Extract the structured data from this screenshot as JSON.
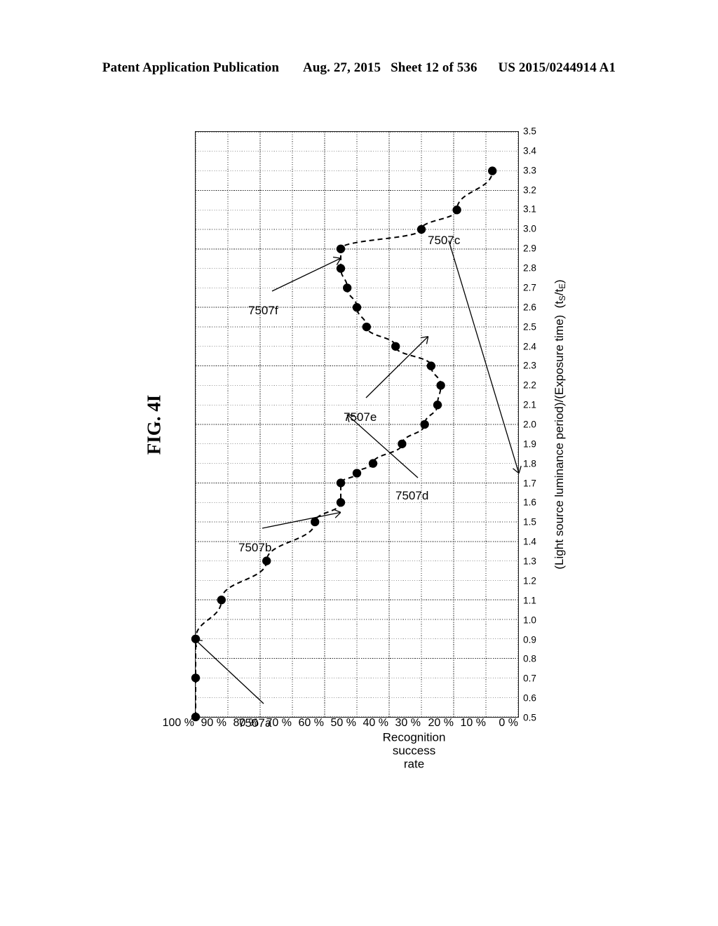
{
  "header": {
    "publication": "Patent Application Publication",
    "date": "Aug. 27, 2015",
    "sheet": "Sheet 12 of 536",
    "docket": "US 2015/0244914 A1"
  },
  "figure": {
    "label": "FIG. 4I"
  },
  "chart_data": {
    "type": "scatter",
    "title": "",
    "xlabel": "(Light source luminance period)/(Exposure time)  (tS/tE)",
    "xlabel_parts": {
      "main": "(Light source luminance period)/(Exposure time)",
      "ratio_open": "(t",
      "sub1": "S",
      "slash": "/t",
      "sub2": "E",
      "ratio_close": ")"
    },
    "ylabel_lines": [
      "Recognition",
      "success",
      "rate"
    ],
    "ylabel": "Recognition success rate",
    "xlim": [
      0.5,
      3.5
    ],
    "ylim": [
      0,
      100
    ],
    "grid": true,
    "legend": "none",
    "xticks": [
      "0.5",
      "0.6",
      "0.7",
      "0.8",
      "0.9",
      "1.0",
      "1.1",
      "1.2",
      "1.3",
      "1.4",
      "1.5",
      "1.6",
      "1.7",
      "1.8",
      "1.9",
      "2.0",
      "2.1",
      "2.2",
      "2.3",
      "2.4",
      "2.5",
      "2.6",
      "2.7",
      "2.8",
      "2.9",
      "3.0",
      "3.1",
      "3.2",
      "3.3",
      "3.4",
      "3.5"
    ],
    "xtick_values": [
      0.5,
      0.6,
      0.7,
      0.8,
      0.9,
      1.0,
      1.1,
      1.2,
      1.3,
      1.4,
      1.5,
      1.6,
      1.7,
      1.8,
      1.9,
      2.0,
      2.1,
      2.2,
      2.3,
      2.4,
      2.5,
      2.6,
      2.7,
      2.8,
      2.9,
      3.0,
      3.1,
      3.2,
      3.3,
      3.4,
      3.5
    ],
    "yticks": [
      "0 %",
      "10 %",
      "20 %",
      "30 %",
      "40 %",
      "50 %",
      "60 %",
      "70 %",
      "80 %",
      "90 %",
      "100 %"
    ],
    "ytick_values": [
      0,
      10,
      20,
      30,
      40,
      50,
      60,
      70,
      80,
      90,
      100
    ],
    "x_major_every": 0.3,
    "y_major_every": 20,
    "series": [
      {
        "name": "Recognition success rate",
        "style": "dashed-line-with-filled-circle-markers",
        "color": "#000000",
        "x": [
          0.5,
          0.7,
          0.9,
          1.1,
          1.3,
          1.5,
          1.6,
          1.7,
          1.75,
          1.8,
          1.9,
          2.0,
          2.1,
          2.2,
          2.3,
          2.4,
          2.5,
          2.6,
          2.7,
          2.8,
          2.9,
          3.0,
          3.1,
          3.3
        ],
        "y": [
          100,
          100,
          100,
          92,
          78,
          63,
          55,
          55,
          50,
          45,
          36,
          29,
          25,
          24,
          27,
          38,
          47,
          50,
          53,
          55,
          55,
          30,
          19,
          8
        ]
      }
    ],
    "callouts": [
      {
        "id": "7507a",
        "label": "7507a",
        "points_to_x": 0.9,
        "points_to_y": 100
      },
      {
        "id": "7507b",
        "label": "7507b",
        "points_to_x": 1.55,
        "points_to_y": 55
      },
      {
        "id": "7507c",
        "label": "7507c",
        "points_to_x": 1.75,
        "points_to_y": 0
      },
      {
        "id": "7507d",
        "label": "7507d",
        "points_to_x": 2.05,
        "points_to_y": 53
      },
      {
        "id": "7507e",
        "label": "7507e",
        "points_to_x": 2.45,
        "points_to_y": 28
      },
      {
        "id": "7507f",
        "label": "7507f",
        "points_to_x": 2.85,
        "points_to_y": 55
      }
    ]
  }
}
